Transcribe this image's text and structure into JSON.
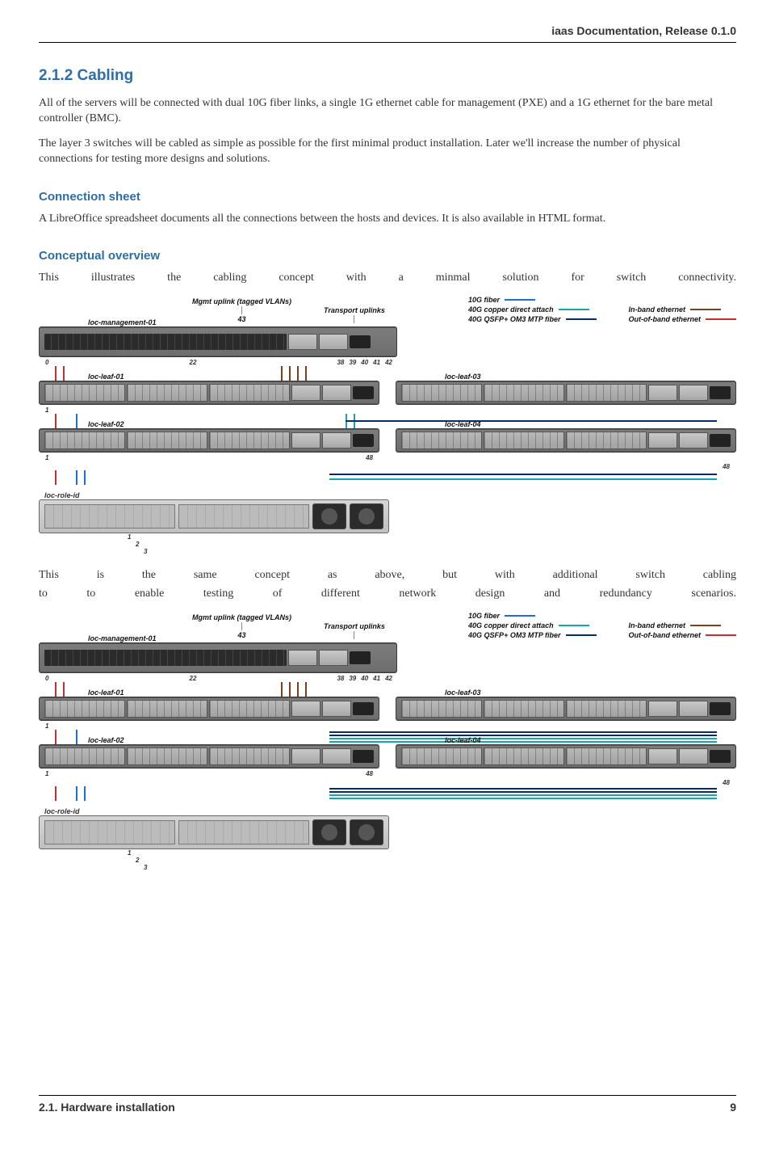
{
  "header": {
    "running": "iaas Documentation, Release 0.1.0"
  },
  "sec": {
    "num_title": "2.1.2 Cabling",
    "p1": "All of the servers will be connected with dual 10G fiber links, a single 1G ethernet cable for management (PXE) and a 1G ethernet for the bare metal controller (BMC).",
    "p2": "The layer 3 switches will be cabled as simple as possible for the first minimal product installation. Later we'll increase the number of physical connections for testing more designs and solutions."
  },
  "conn": {
    "title": "Connection sheet",
    "p": "A LibreOffice spreadsheet documents all the connections between the hosts and devices. It is also available in HTML format."
  },
  "ov": {
    "title": "Conceptual overview",
    "p1": "This illustrates the cabling concept with a minmal solution for switch connectivity.",
    "p2a": "This is the same concept as above, but with additional switch cabling",
    "p2b": "to to enable testing of different network design and redundancy scenarios."
  },
  "legend": {
    "mgmt": "Mgmt uplink (tagged VLANs)",
    "mgmt_port": "43",
    "transport": "Transport uplinks",
    "left": [
      {
        "label": "10G fiber",
        "cls": "sw-blue"
      },
      {
        "label": "40G copper direct attach",
        "cls": "sw-teal"
      },
      {
        "label": "40G QSFP+ OM3 MTP fiber",
        "cls": "sw-navy"
      }
    ],
    "right": [
      {
        "label": "In-band ethernet",
        "cls": "sw-brown"
      },
      {
        "label": "Out-of-band ethernet",
        "cls": "sw-red"
      }
    ]
  },
  "devices": {
    "mgmt": "loc-management-01",
    "leaf01": "loc-leaf-01",
    "leaf02": "loc-leaf-02",
    "leaf03": "loc-leaf-03",
    "leaf04": "loc-leaf-04",
    "server": "loc-role-id"
  },
  "ports": {
    "mgmt_left": "0",
    "mgmt_mid": "22",
    "mgmt_cluster": [
      "38",
      "39",
      "40",
      "41",
      "42"
    ],
    "leaf_left": "1",
    "leaf_right": "48",
    "srv": [
      "1",
      "2",
      "3"
    ]
  },
  "footer": {
    "left": "2.1.  Hardware installation",
    "right": "9"
  }
}
